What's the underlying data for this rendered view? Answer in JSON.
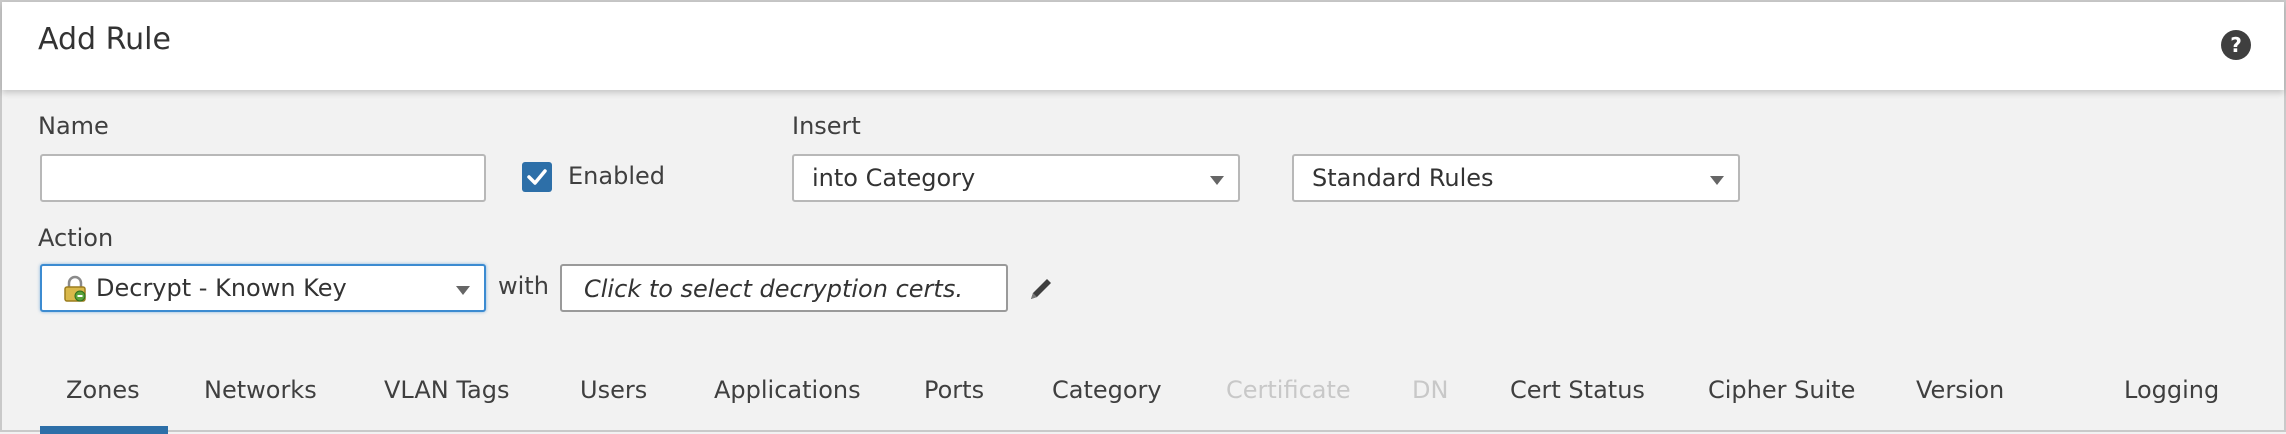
{
  "dialog": {
    "title": "Add Rule",
    "help_icon": "question-icon",
    "help_glyph": "?"
  },
  "form": {
    "name_label": "Name",
    "name_value": "",
    "enabled_label": "Enabled",
    "enabled_checked": true,
    "insert_label": "Insert",
    "insert_value": "into Category",
    "category_value": "Standard Rules",
    "action_label": "Action",
    "action_value": "Decrypt - Known Key",
    "with_label": "with",
    "certs_placeholder": "Click to select decryption certs."
  },
  "tabs": [
    {
      "label": "Zones",
      "active": true,
      "enabled": true
    },
    {
      "label": "Networks",
      "active": false,
      "enabled": true
    },
    {
      "label": "VLAN Tags",
      "active": false,
      "enabled": true
    },
    {
      "label": "Users",
      "active": false,
      "enabled": true
    },
    {
      "label": "Applications",
      "active": false,
      "enabled": true
    },
    {
      "label": "Ports",
      "active": false,
      "enabled": true
    },
    {
      "label": "Category",
      "active": false,
      "enabled": true
    },
    {
      "label": "Certificate",
      "active": false,
      "enabled": false
    },
    {
      "label": "DN",
      "active": false,
      "enabled": false
    },
    {
      "label": "Cert Status",
      "active": false,
      "enabled": true
    },
    {
      "label": "Cipher Suite",
      "active": false,
      "enabled": true
    },
    {
      "label": "Version",
      "active": false,
      "enabled": true
    },
    {
      "label": "Logging",
      "active": false,
      "enabled": true
    }
  ],
  "colors": {
    "accent": "#2d6fa8",
    "focus_border": "#3c8bd1",
    "disabled_text": "#c8c8c8"
  }
}
